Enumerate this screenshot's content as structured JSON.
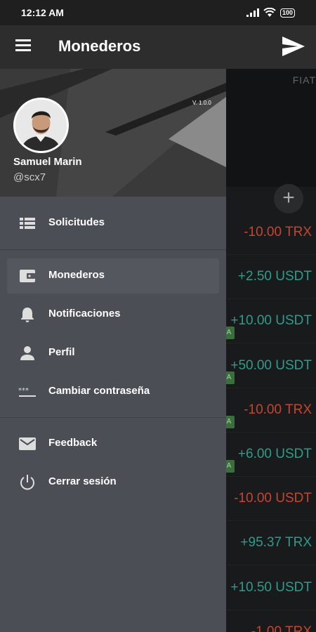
{
  "status_bar": {
    "time": "12:12 AM",
    "battery": "100"
  },
  "app_bar": {
    "title": "Monederos",
    "menu_icon": "hamburger-menu-icon",
    "action_icon": "send-icon"
  },
  "background": {
    "fiat_label": "FIAT",
    "add_icon": "plus-icon",
    "add_symbol": "+",
    "transactions": [
      {
        "amount": "-10.00 TRX",
        "color": "#c6452f",
        "badge": ""
      },
      {
        "amount": "+2.50 USDT",
        "color": "#2d9d8b",
        "badge": ""
      },
      {
        "amount": "+10.00 USDT",
        "color": "#2d9d8b",
        "badge": "A"
      },
      {
        "amount": "+50.00 USDT",
        "color": "#2d9d8b",
        "badge": "A"
      },
      {
        "amount": "-10.00 TRX",
        "color": "#c6452f",
        "badge": "A"
      },
      {
        "amount": "+6.00 USDT",
        "color": "#2d9d8b",
        "badge": "A"
      },
      {
        "amount": "-10.00 USDT",
        "color": "#c6452f",
        "badge": ""
      },
      {
        "amount": "+95.37 TRX",
        "color": "#2d9d8b",
        "badge": ""
      },
      {
        "amount": "+10.50 USDT",
        "color": "#2d9d8b",
        "badge": ""
      },
      {
        "amount": "-1.00 TRX",
        "color": "#c6452f",
        "badge": ""
      }
    ]
  },
  "drawer": {
    "version": "V. 1.0.0",
    "user_name": "Samuel Marin",
    "user_handle": "@scx7",
    "items": [
      {
        "label": "Solicitudes",
        "icon": "list-icon",
        "active": false
      },
      {
        "label": "Monederos",
        "icon": "wallet-icon",
        "active": true
      },
      {
        "label": "Notificaciones",
        "icon": "bell-icon",
        "active": false
      },
      {
        "label": "Perfil",
        "icon": "person-icon",
        "active": false
      },
      {
        "label": "Cambiar contraseña",
        "icon": "password-icon",
        "active": false
      },
      {
        "label": "Feedback",
        "icon": "mail-icon",
        "active": false
      },
      {
        "label": "Cerrar sesión",
        "icon": "power-icon",
        "active": false
      }
    ]
  },
  "colors": {
    "drawer_bg": "#4b4e55",
    "app_bar_bg": "#2d2d2d",
    "positive": "#2d9d8b",
    "negative": "#c6452f"
  }
}
